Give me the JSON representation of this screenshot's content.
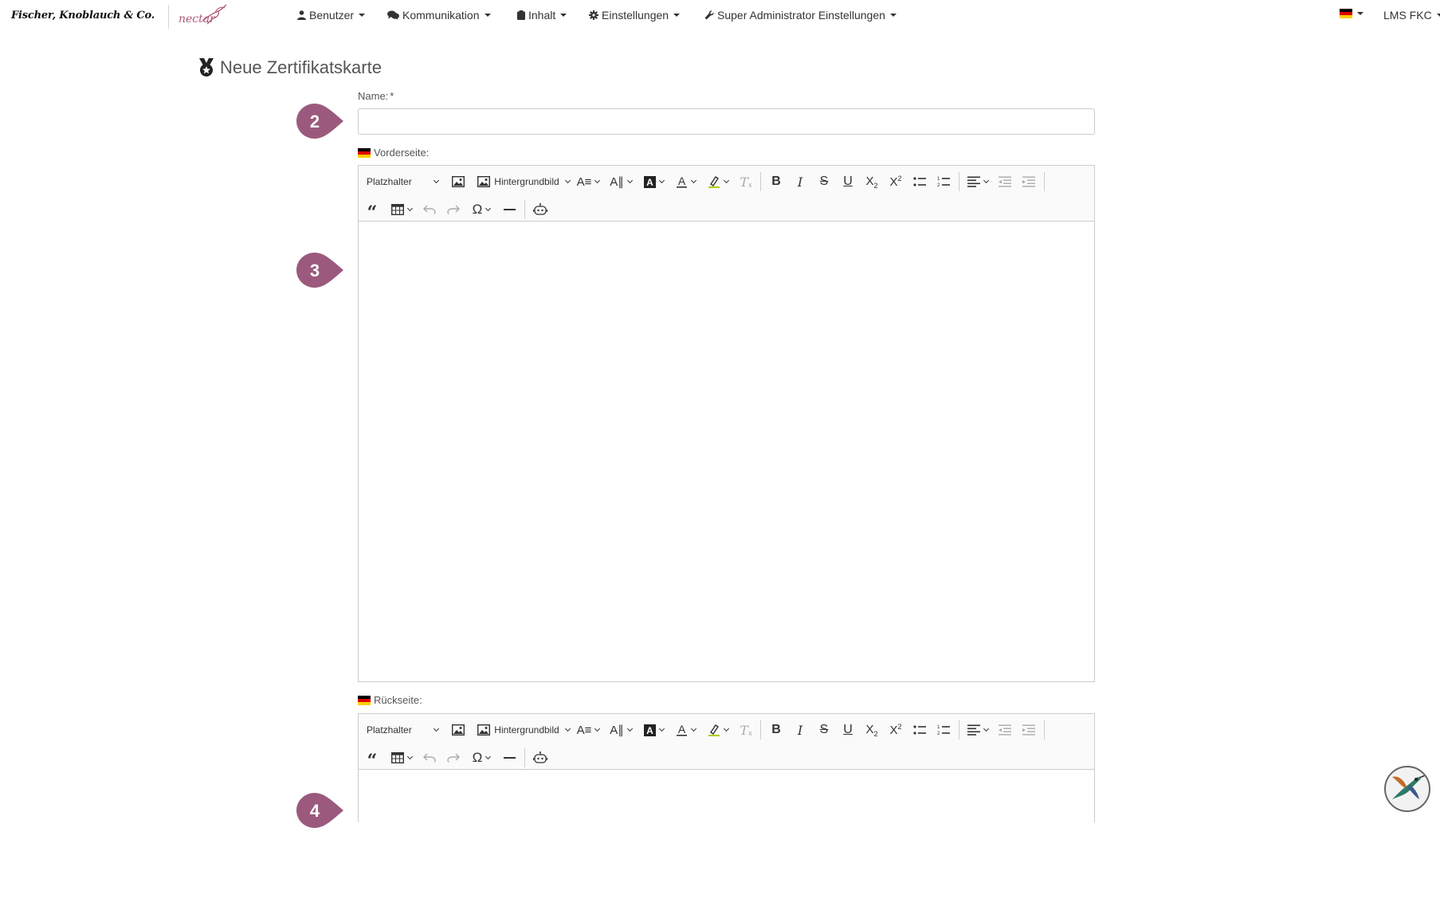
{
  "brand": {
    "company": "Fischer, Knoblauch & Co.",
    "product": "nectar"
  },
  "nav": {
    "items": [
      {
        "label": "Benutzer",
        "icon": "user-icon"
      },
      {
        "label": "Kommunikation",
        "icon": "comments-icon"
      },
      {
        "label": "Inhalt",
        "icon": "clipboard-icon"
      },
      {
        "label": "Einstellungen",
        "icon": "gear-icon"
      },
      {
        "label": "Super Administrator Einstellungen",
        "icon": "wrench-icon"
      }
    ],
    "language_flag": "de-flag-icon",
    "account_label": "LMS FKC"
  },
  "page": {
    "title": "Neue Zertifikatskarte",
    "icon": "certificate-award-icon"
  },
  "form": {
    "name_label": "Name:",
    "required_mark": "*",
    "name_value": "",
    "front_label": "Vorderseite:",
    "back_label": "Rückseite:"
  },
  "toolbar": {
    "placeholder_dropdown": "Platzhalter",
    "background_image": "Hintergrundbild"
  },
  "markers": [
    "2",
    "3",
    "4"
  ],
  "colors": {
    "marker": "#9b5a7d",
    "accent_pink": "#b0567a",
    "border": "#cccccc"
  }
}
